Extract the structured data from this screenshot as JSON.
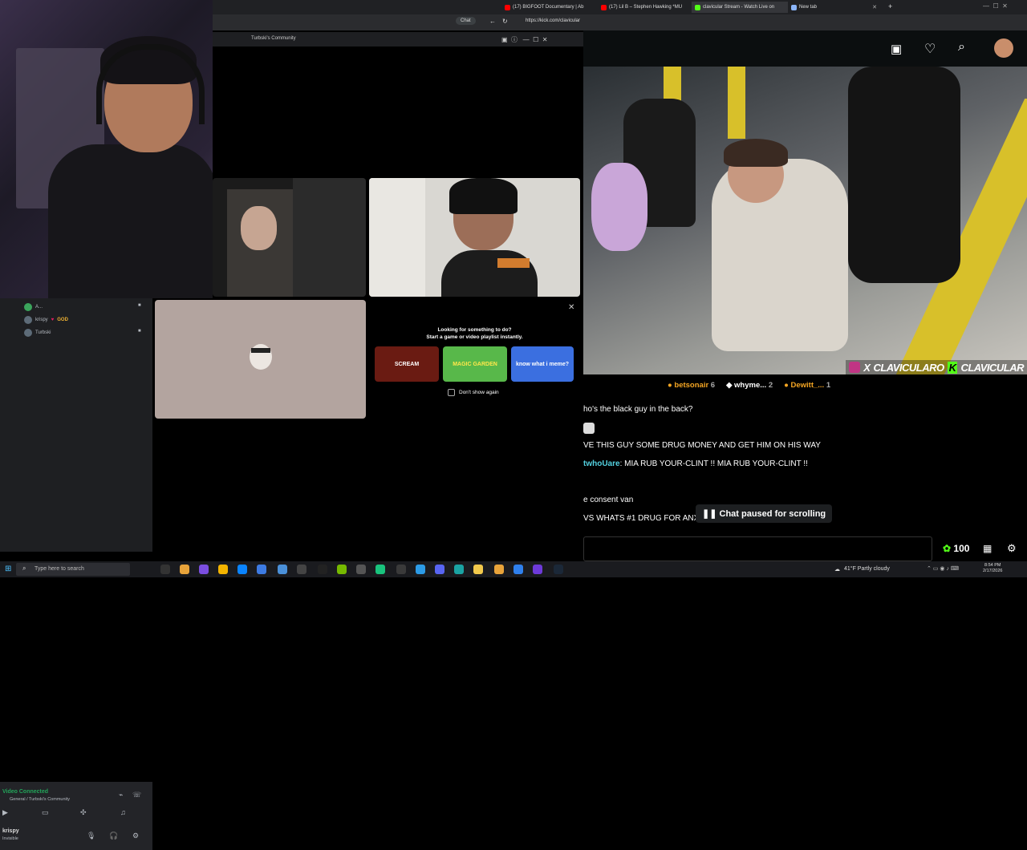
{
  "browser": {
    "tabs": [
      {
        "label": "(17) BIGFOOT Documentary | Ab",
        "color": "#ff0000"
      },
      {
        "label": "(17) Lil B – Stephen Hawking *MU",
        "color": "#ff0000"
      },
      {
        "label": "clavicular Stream - Watch Live on",
        "color": "#53fc18"
      },
      {
        "label": "New tab",
        "color": "#8ab4f8"
      }
    ],
    "chat_chip": "Chat",
    "url": "https://kick.com/clavicular"
  },
  "discord": {
    "window_title": "Turbski's Community",
    "voice_users": [
      {
        "name": "A..."
      },
      {
        "name": "krispy",
        "badge": "GOD"
      },
      {
        "name": "Turbski"
      }
    ],
    "promo": {
      "line1": "Looking for something to do?",
      "line2": "Start a game or video playlist instantly.",
      "cards": [
        {
          "text": "SCREAM",
          "color": "#6a1b12"
        },
        {
          "text": "MAGIC GARDEN",
          "color": "#58b84a"
        },
        {
          "text": "know what i meme?",
          "color": "#3b6fe0"
        }
      ],
      "checkbox_label": "Don't show again"
    },
    "connection": {
      "status": "Video Connected",
      "channel": "General / Turbski's Community"
    },
    "user": {
      "name": "krispy",
      "status": "Invisible"
    }
  },
  "stream": {
    "social_handle_1": "CLAVICULARO",
    "social_handle_2": "CLAVICULAR"
  },
  "chat": {
    "gifters": [
      {
        "name": "betsonair",
        "count": "6",
        "color": "#f5a623"
      },
      {
        "name": "whyme...",
        "count": "2",
        "color": "#ffffff"
      },
      {
        "name": "Dewitt_...",
        "count": "1",
        "color": "#f5a623"
      }
    ],
    "messages": [
      {
        "user": "",
        "text": "ho's the black guy in the back?"
      },
      {
        "user": "",
        "text": "VE THIS GUY SOME DRUG MONEY AND GET HIM ON HIS WAY"
      },
      {
        "user": "twhoUare",
        "text": "MIA RUB YOUR-CLINT !! MIA RUB YOUR-CLINT !!"
      },
      {
        "user": "",
        "text": "e consent van"
      },
      {
        "user": "",
        "text": "VS WHATS #1 DRUG FOR ANX"
      }
    ],
    "paused_label": "Chat paused for scrolling",
    "points": "100"
  },
  "taskbar": {
    "search_placeholder": "Type here to search",
    "weather": "41°F  Partly cloudy",
    "time": "8:54 PM",
    "date": "2/17/2026"
  }
}
